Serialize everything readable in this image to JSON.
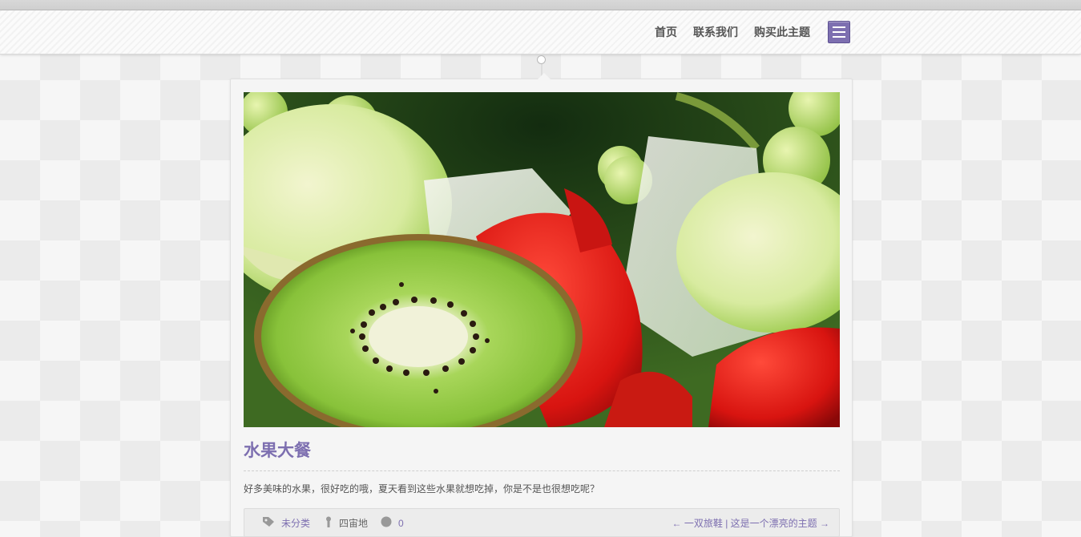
{
  "nav": {
    "items": [
      {
        "label": "首页"
      },
      {
        "label": "联系我们"
      },
      {
        "label": "购买此主题"
      }
    ],
    "menu_icon": "hamburger-menu-icon"
  },
  "post": {
    "title": "水果大餐",
    "image_alt": "水果大餐",
    "excerpt": "好多美味的水果，很好吃的哦，夏天看到这些水果就想吃掉，你是不是也很想吃呢？",
    "meta": {
      "category": "未分类",
      "author": "四宙地",
      "comments": "0",
      "prev_post": "← 一双旅鞋",
      "separator": "|",
      "next_post": "这是一个漂亮的主题 →"
    }
  },
  "colors": {
    "accent": "#7d6fb0",
    "background": "#ebebeb",
    "card": "#f5f5f5"
  },
  "icons": [
    "tag-icon",
    "user-icon",
    "comment-icon",
    "hamburger-menu-icon"
  ]
}
